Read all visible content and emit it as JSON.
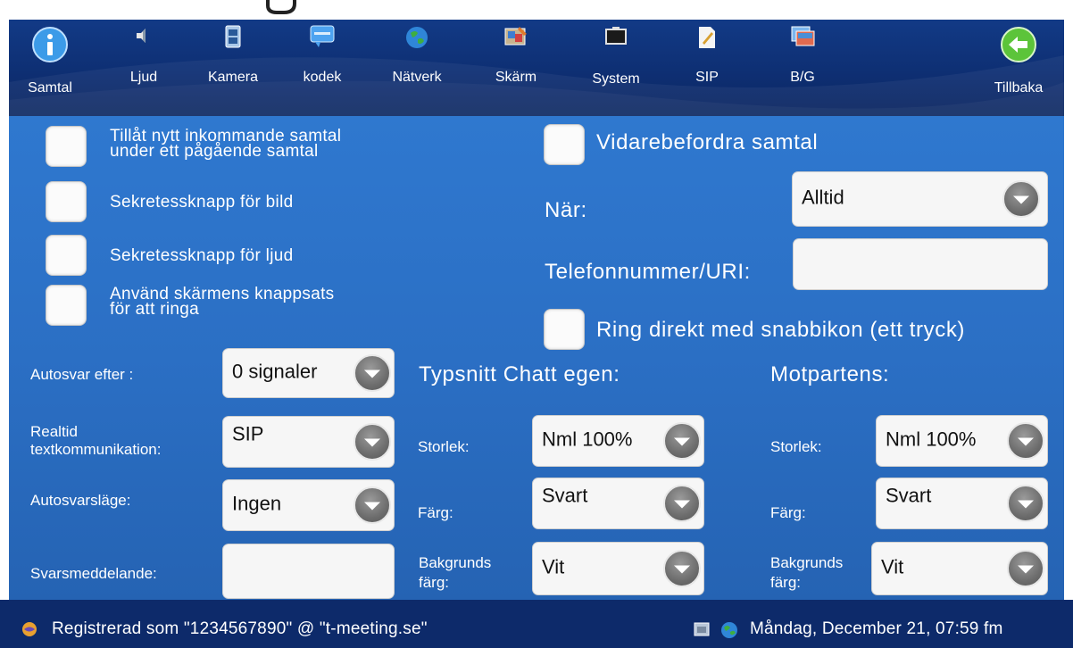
{
  "toolbar": {
    "items": [
      {
        "label": "Samtal",
        "icon": "info-icon"
      },
      {
        "label": "Ljud",
        "icon": "speaker-icon"
      },
      {
        "label": "Kamera",
        "icon": "camera-film-icon"
      },
      {
        "label": "kodek",
        "icon": "codec-icon"
      },
      {
        "label": "Nätverk",
        "icon": "globe-icon"
      },
      {
        "label": "Skärm",
        "icon": "screen-paint-icon"
      },
      {
        "label": "System",
        "icon": "system-box-icon"
      },
      {
        "label": "SIP",
        "icon": "sip-document-icon"
      },
      {
        "label": "B/G",
        "icon": "background-image-icon"
      },
      {
        "label": "Tillbaka",
        "icon": "back-arrow-icon"
      }
    ],
    "accent_color": "#123a86"
  },
  "left": {
    "allow_call_line1": "Tillåt nytt inkommande samtal",
    "allow_call_line2": "under ett pågående samtal",
    "privacy_video": "Sekretessknapp för bild",
    "privacy_audio": "Sekretessknapp för ljud",
    "keypad_line1": "Använd skärmens knappsats",
    "keypad_line2": "för att ringa"
  },
  "right": {
    "forward_label": "Vidarebefordra samtal",
    "when_label": "När:",
    "when_value": "Alltid",
    "phone_label": "Telefonnummer/URI:",
    "phone_value": "",
    "speed_dial_label": "Ring direkt med snabbikon (ett tryck)"
  },
  "settings": {
    "autoanswer_label": "Autosvar efter :",
    "autoanswer_value": "0 signaler",
    "rtt_line1": "Realtid",
    "rtt_line2": "textkommunikation:",
    "rtt_value": "SIP",
    "autoanswer_mode_label": "Autosvarsläge:",
    "autoanswer_mode_value": "Ingen",
    "reply_msg_label": "Svarsmeddelande:",
    "reply_msg_value": ""
  },
  "chat_own": {
    "heading": "Typsnitt Chatt egen:",
    "size_label": "Storlek:",
    "size_value": "Nml 100%",
    "color_label": "Färg:",
    "color_value": "Svart",
    "bg_line1": "Bakgrunds",
    "bg_line2": "färg:",
    "bg_value": "Vit"
  },
  "chat_peer": {
    "heading": "Motpartens:",
    "size_label": "Storlek:",
    "size_value": "Nml 100%",
    "color_label": "Färg:",
    "color_value": "Svart",
    "bg_line1": "Bakgrunds",
    "bg_line2": "färg:",
    "bg_value": "Vit"
  },
  "status": {
    "registration": "Registrerad som \"1234567890\" @ \"t-meeting.se\"",
    "datetime": "Måndag, December 21, 07:59 fm"
  }
}
